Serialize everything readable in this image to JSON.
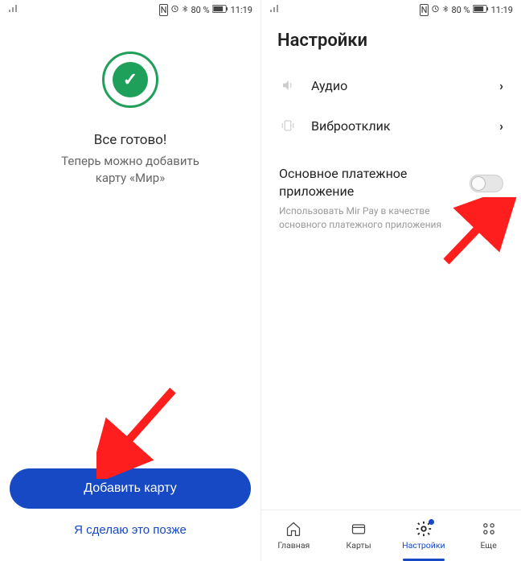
{
  "status": {
    "battery": "80 %",
    "time": "11:19"
  },
  "screen1": {
    "title": "Все готово!",
    "subtitle_line1": "Теперь можно добавить",
    "subtitle_line2": "карту «Мир»",
    "add_card_label": "Добавить карту",
    "later_label": "Я сделаю это позже"
  },
  "screen2": {
    "header": "Настройки",
    "rows": {
      "audio": "Аудио",
      "vibro": "Виброотклик"
    },
    "toggle": {
      "title_line1": "Основное платежное",
      "title_line2": "приложение",
      "desc_line1": "Использовать Mir Pay в качестве",
      "desc_line2": "основного платежного приложения",
      "on": false
    },
    "nav": {
      "home": "Главная",
      "cards": "Карты",
      "settings": "Настройки",
      "more": "Еще"
    }
  }
}
